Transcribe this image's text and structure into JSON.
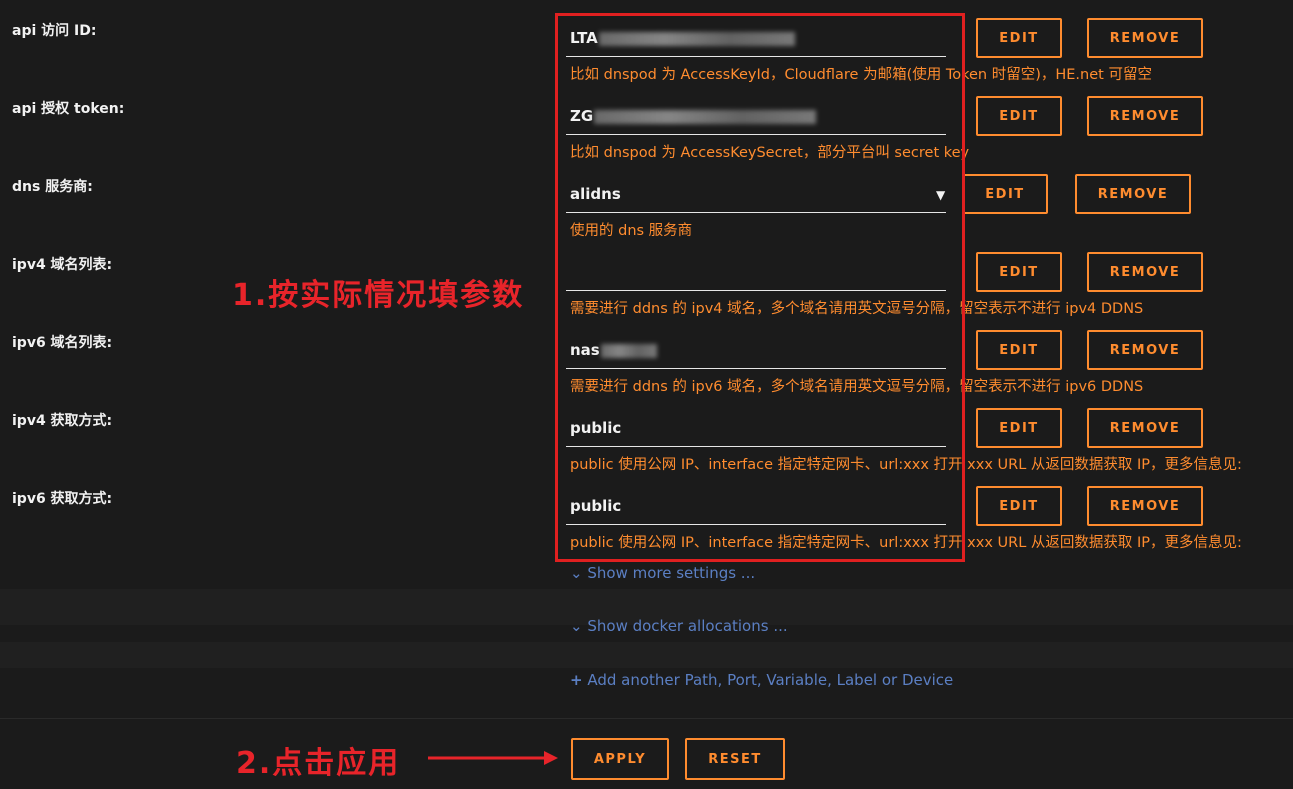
{
  "fields": [
    {
      "label": "api 访问 ID:",
      "value": "LTA",
      "help": "比如 dnspod 为 AccessKeyId，Cloudflare 为邮箱(使用 Token 时留空)，HE.net 可留空"
    },
    {
      "label": "api 授权 token:",
      "value": "ZG",
      "help": "比如 dnspod 为 AccessKeySecret，部分平台叫 secret key"
    },
    {
      "label": "dns 服务商:",
      "value": "alidns",
      "help": "使用的 dns 服务商",
      "type": "select"
    },
    {
      "label": "ipv4 域名列表:",
      "value": "",
      "help": "需要进行 ddns 的 ipv4 域名，多个域名请用英文逗号分隔，留空表示不进行 ipv4 DDNS"
    },
    {
      "label": "ipv6 域名列表:",
      "value": "nas",
      "help": "需要进行 ddns 的 ipv6 域名，多个域名请用英文逗号分隔，留空表示不进行 ipv6 DDNS"
    },
    {
      "label": "ipv4 获取方式:",
      "value": "public",
      "help": "public 使用公网 IP、interface 指定特定网卡、url:xxx 打开 xxx URL 从返回数据获取 IP，更多信息见:"
    },
    {
      "label": "ipv6 获取方式:",
      "value": "public",
      "help": "public 使用公网 IP、interface 指定特定网卡、url:xxx 打开 xxx URL 从返回数据获取 IP，更多信息见:"
    }
  ],
  "buttons": {
    "edit": "EDIT",
    "remove": "REMOVE",
    "apply": "APPLY",
    "reset": "RESET"
  },
  "links": {
    "more_settings": "Show more settings ...",
    "docker_allocations": "Show docker allocations ...",
    "add_another": "Add another Path, Port, Variable, Label or Device"
  },
  "annotations": {
    "step1": "1.按实际情况填参数",
    "step2": "2.点击应用"
  },
  "colors": {
    "accent": "#ff8c2f",
    "link": "#5b7fc3",
    "annotation": "#e8242a",
    "background": "#1b1b1b"
  }
}
